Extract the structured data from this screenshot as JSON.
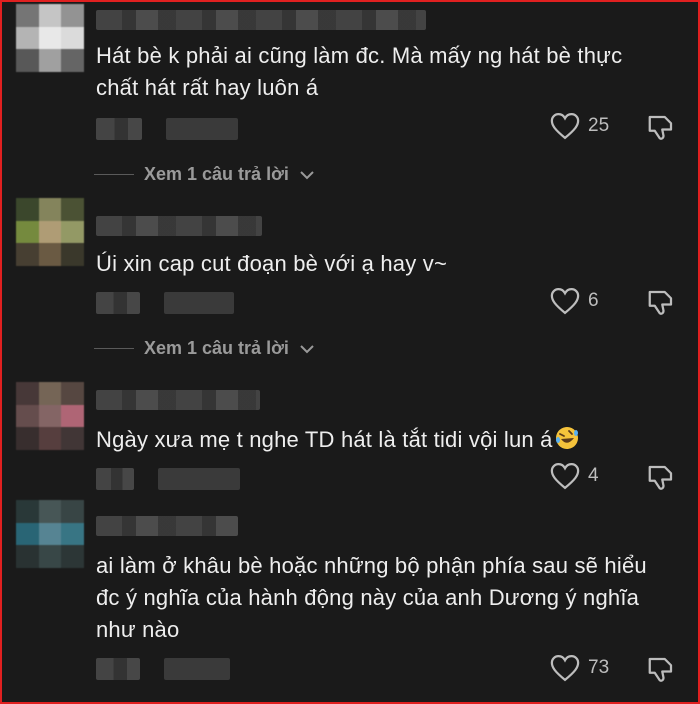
{
  "comments": [
    {
      "text": "Hát bè k phải ai cũng làm đc. Mà mấy ng hát bè thực chất hát rất hay luôn á",
      "likes": "25",
      "replies_label": "Xem 1 câu trả lời"
    },
    {
      "text": "Úi xin cap cut đoạn bè với ạ hay v~",
      "likes": "6",
      "replies_label": "Xem 1 câu trả lời"
    },
    {
      "text": "Ngày xưa mẹ t nghe TD hát là tắt tidi vội lun á",
      "likes": "4",
      "emoji": "rolling-on-floor-laughing-emoji"
    },
    {
      "text": "ai làm ở khâu bè hoặc những bộ phận phía sau sẽ hiểu đc ý nghĩa của hành động này của anh Dương ý nghĩa như nào",
      "likes": "73"
    }
  ],
  "icons": {
    "like": "heart-outline-icon",
    "dislike": "thumbs-down-outline-icon",
    "expand": "chevron-down-icon"
  },
  "colors": {
    "background": "#1a1a1a",
    "border": "#e02020",
    "text": "#eeeeee",
    "muted": "#9a9a9a"
  }
}
